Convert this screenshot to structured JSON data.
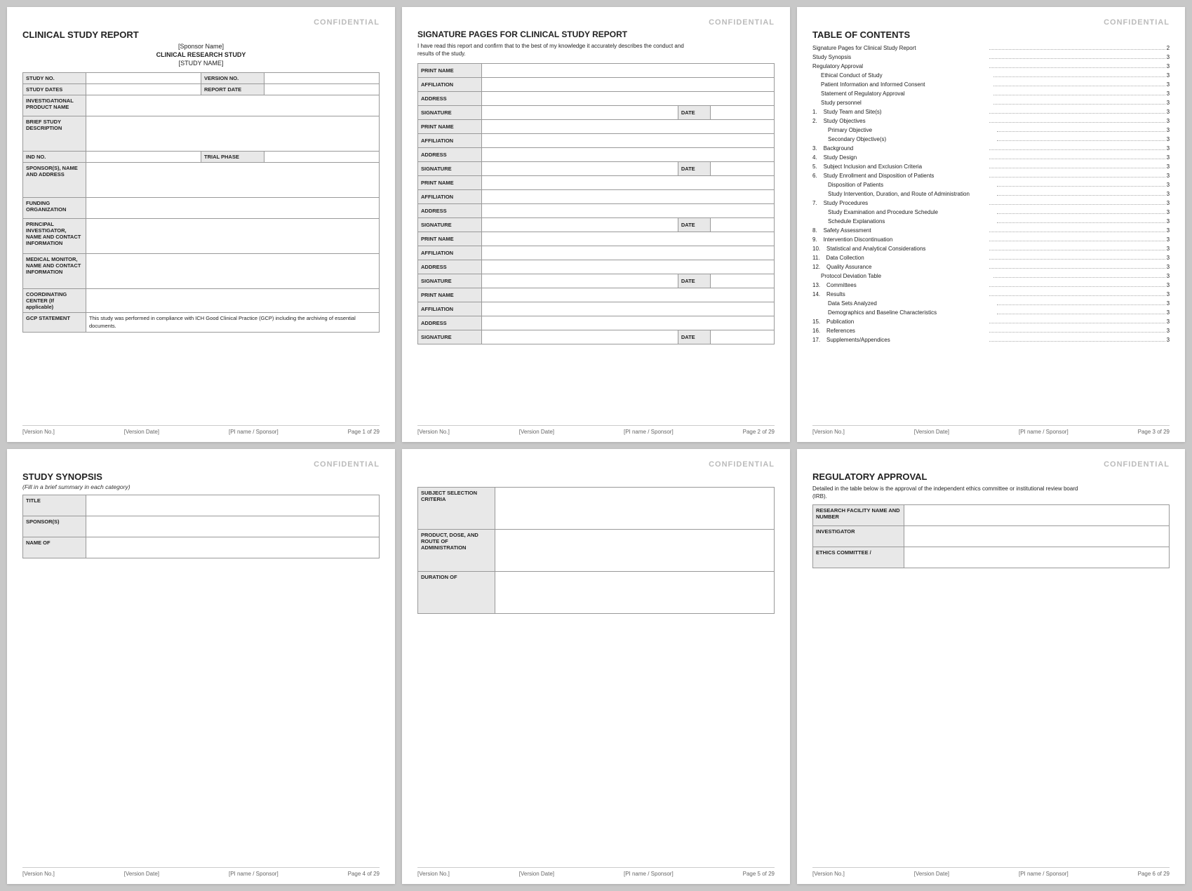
{
  "pages": [
    {
      "id": "page1",
      "confidential": "CONFIDENTIAL",
      "title": "CLINICAL STUDY REPORT",
      "sponsor_name": "[Sponsor Name]",
      "study_type": "CLINICAL RESEARCH STUDY",
      "study_name": "[STUDY NAME]",
      "table": {
        "rows": [
          {
            "label": "STUDY NO.",
            "value": "",
            "extra_label": "VERSION NO.",
            "extra_value": ""
          },
          {
            "label": "STUDY DATES",
            "value": "",
            "extra_label": "REPORT DATE",
            "extra_value": ""
          },
          {
            "label": "INVESTIGATIONAL PRODUCT NAME",
            "value": ""
          },
          {
            "label": "BRIEF STUDY DESCRIPTION",
            "value": ""
          },
          {
            "label": "IND NO.",
            "value": "",
            "extra_label": "TRIAL PHASE",
            "extra_value": ""
          },
          {
            "label": "SPONSOR(S), NAME AND ADDRESS",
            "value": ""
          },
          {
            "label": "FUNDING ORGANIZATION",
            "value": ""
          },
          {
            "label": "PRINCIPAL INVESTIGATOR, NAME AND CONTACT INFORMATION",
            "value": ""
          },
          {
            "label": "MEDICAL MONITOR, NAME AND CONTACT INFORMATION",
            "value": ""
          },
          {
            "label": "COORDINATING CENTER (If applicable)",
            "value": ""
          },
          {
            "label": "GCP STATEMENT",
            "value": "This study was performed in compliance with ICH Good Clinical Practice (GCP) including the archiving of essential documents."
          }
        ]
      },
      "footer": {
        "version_no": "[Version No.]",
        "pi_sponsor": "[PI name / Sponsor]",
        "page": "Page 1 of 29",
        "version_date": "[Version Date]"
      }
    },
    {
      "id": "page2",
      "confidential": "CONFIDENTIAL",
      "title": "SIGNATURE PAGES FOR CLINICAL STUDY REPORT",
      "intro": "I have read this report and confirm that to the best of my knowledge it accurately describes the conduct and results of the study.",
      "sig_groups": [
        {
          "fields": [
            "PRINT NAME",
            "AFFILIATION",
            "ADDRESS",
            "SIGNATURE",
            "DATE"
          ]
        },
        {
          "fields": [
            "PRINT NAME",
            "AFFILIATION",
            "ADDRESS",
            "SIGNATURE",
            "DATE"
          ]
        },
        {
          "fields": [
            "PRINT NAME",
            "AFFILIATION",
            "ADDRESS",
            "SIGNATURE",
            "DATE"
          ]
        },
        {
          "fields": [
            "PRINT NAME",
            "AFFILIATION",
            "ADDRESS",
            "SIGNATURE",
            "DATE"
          ]
        },
        {
          "fields": [
            "PRINT NAME",
            "AFFILIATION",
            "ADDRESS",
            "SIGNATURE",
            "DATE"
          ]
        }
      ],
      "footer": {
        "version_no": "[Version No.]",
        "pi_sponsor": "[PI name / Sponsor]",
        "page": "Page 2 of 29",
        "version_date": "[Version Date]"
      }
    },
    {
      "id": "page3",
      "confidential": "CONFIDENTIAL",
      "title": "TABLE OF CONTENTS",
      "toc": [
        {
          "label": "Signature Pages for Clinical Study Report",
          "page": "2",
          "indent": 0
        },
        {
          "label": "Study Synopsis",
          "page": "3",
          "indent": 0
        },
        {
          "label": "Regulatory Approval",
          "page": "3",
          "indent": 0
        },
        {
          "label": "Ethical Conduct of Study",
          "page": "3",
          "indent": 1
        },
        {
          "label": "Patient Information and Informed Consent",
          "page": "3",
          "indent": 1
        },
        {
          "label": "Statement of Regulatory Approval",
          "page": "3",
          "indent": 1
        },
        {
          "label": "Study personnel",
          "page": "3",
          "indent": 1
        },
        {
          "label": "1.   Study Team and Site(s)",
          "page": "3",
          "indent": 0
        },
        {
          "label": "2.   Study Objectives",
          "page": "3",
          "indent": 0
        },
        {
          "label": "Primary Objective",
          "page": "3",
          "indent": 2
        },
        {
          "label": "Secondary Objective(s)",
          "page": "3",
          "indent": 2
        },
        {
          "label": "3.   Background",
          "page": "3",
          "indent": 0
        },
        {
          "label": "4.   Study Design",
          "page": "3",
          "indent": 0
        },
        {
          "label": "5.   Subject Inclusion and Exclusion Criteria",
          "page": "3",
          "indent": 0
        },
        {
          "label": "6.   Study Enrollment and Disposition of Patients",
          "page": "3",
          "indent": 0
        },
        {
          "label": "Disposition of Patients",
          "page": "3",
          "indent": 2
        },
        {
          "label": "Study Intervention, Duration, and Route of Administration",
          "page": "3",
          "indent": 2
        },
        {
          "label": "7.   Study Procedures",
          "page": "3",
          "indent": 0
        },
        {
          "label": "Study Examination and Procedure Schedule",
          "page": "3",
          "indent": 2
        },
        {
          "label": "Schedule Explanations",
          "page": "3",
          "indent": 2
        },
        {
          "label": "8.   Safety Assessment",
          "page": "3",
          "indent": 0
        },
        {
          "label": "9.   Intervention Discontinuation",
          "page": "3",
          "indent": 0
        },
        {
          "label": "10.   Statistical and Analytical Considerations",
          "page": "3",
          "indent": 0
        },
        {
          "label": "11.   Data Collection",
          "page": "3",
          "indent": 0
        },
        {
          "label": "12.   Quality Assurance",
          "page": "3",
          "indent": 0
        },
        {
          "label": "Protocol Deviation Table",
          "page": "3",
          "indent": 1
        },
        {
          "label": "13.   Committees",
          "page": "3",
          "indent": 0
        },
        {
          "label": "14.   Results",
          "page": "3",
          "indent": 0
        },
        {
          "label": "Data Sets Analyzed",
          "page": "3",
          "indent": 2
        },
        {
          "label": "Demographics and Baseline Characteristics",
          "page": "3",
          "indent": 2
        },
        {
          "label": "15.   Publication",
          "page": "3",
          "indent": 0
        },
        {
          "label": "16.   References",
          "page": "3",
          "indent": 0
        },
        {
          "label": "17.   Supplements/Appendices",
          "page": "3",
          "indent": 0
        }
      ],
      "footer": {
        "version_no": "[Version No.]",
        "pi_sponsor": "[PI name / Sponsor]",
        "page": "Page 3 of 29",
        "version_date": "[Version Date]"
      }
    },
    {
      "id": "page4",
      "confidential": "CONFIDENTIAL",
      "title": "STUDY SYNOPSIS",
      "subtitle": "(Fill in a brief summary in each category)",
      "table": {
        "rows": [
          {
            "label": "TITLE",
            "value": ""
          },
          {
            "label": "SPONSOR(S)",
            "value": ""
          },
          {
            "label": "NAME OF",
            "value": ""
          }
        ]
      },
      "footer": {
        "version_no": "[Version No.]",
        "pi_sponsor": "[PI name / Sponsor]",
        "page": "Page 4 of 29",
        "version_date": "[Version Date]"
      }
    },
    {
      "id": "page5",
      "confidential": "CONFIDENTIAL",
      "table": {
        "rows": [
          {
            "label": "SUBJECT SELECTION CRITERIA",
            "value": ""
          },
          {
            "label": "PRODUCT, DOSE, AND ROUTE OF ADMINISTRATION",
            "value": ""
          },
          {
            "label": "DURATION OF",
            "value": ""
          }
        ]
      },
      "footer": {
        "version_no": "[Version No.]",
        "pi_sponsor": "[PI name / Sponsor]",
        "page": "Page 5 of 29",
        "version_date": "[Version Date]"
      }
    },
    {
      "id": "page6",
      "confidential": "CONFIDENTIAL",
      "title": "REGULATORY APPROVAL",
      "intro": "Detailed in the table below is the approval of the independent ethics committee or institutional review board (IRB).",
      "table": {
        "rows": [
          {
            "label": "RESEARCH FACILITY NAME AND NUMBER",
            "value": ""
          },
          {
            "label": "INVESTIGATOR",
            "value": ""
          },
          {
            "label": "ETHICS COMMITTEE /",
            "value": ""
          }
        ]
      },
      "footer": {
        "version_no": "[Version No.]",
        "pi_sponsor": "[PI name / Sponsor]",
        "page": "Page 6 of 29",
        "version_date": "[Version Date]"
      }
    }
  ]
}
